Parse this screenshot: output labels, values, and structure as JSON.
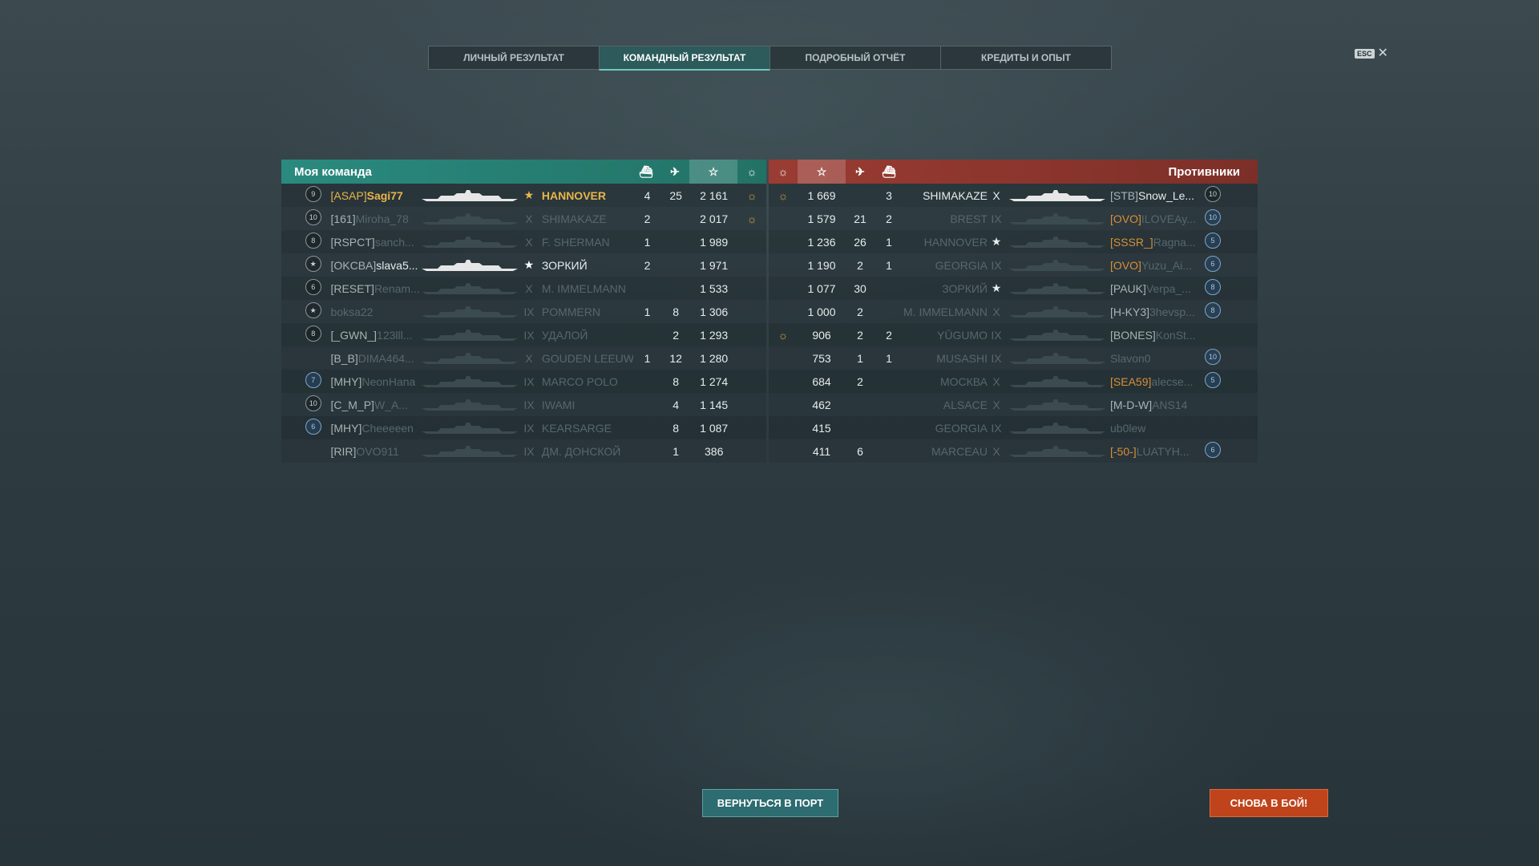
{
  "tabs": [
    {
      "label": "ЛИЧНЫЙ РЕЗУЛЬТАТ"
    },
    {
      "label": "КОМАНДНЫЙ РЕЗУЛЬТАТ"
    },
    {
      "label": "ПОДРОБНЫЙ ОТЧЁТ"
    },
    {
      "label": "КРЕДИТЫ И ОПЫТ"
    }
  ],
  "esc": {
    "key": "ESC",
    "close": "✕"
  },
  "my_team": {
    "title": "Моя команда",
    "rows": [
      {
        "lvl": "9",
        "clan": "[ASAP]",
        "name": "Sagi77",
        "tier": "★",
        "ship": "HANNOVER",
        "kills": "4",
        "planes": "25",
        "xp": "2 161",
        "self": true
      },
      {
        "lvl": "10",
        "clan": "[161]",
        "name": "Miroha_78",
        "tier": "X",
        "ship": "SHIMAKAZE",
        "kills": "2",
        "planes": "",
        "xp": "2 017"
      },
      {
        "lvl": "8",
        "clan": "[RSPCT]",
        "name": "sanch...",
        "tier": "X",
        "ship": "F. SHERMAN",
        "kills": "1",
        "planes": "",
        "xp": "1 989"
      },
      {
        "lvl": "★",
        "clan": "[OKCBA]",
        "name": "slava5...",
        "tier": "★",
        "ship": "ЗОРКИЙ",
        "kills": "2",
        "planes": "",
        "xp": "1 971"
      },
      {
        "lvl": "6",
        "clan": "[RESET]",
        "name": "Renam...",
        "tier": "X",
        "ship": "M. IMMELMANN",
        "kills": "",
        "planes": "",
        "xp": "1 533"
      },
      {
        "lvl": "★",
        "clan": "",
        "name": "boksa22",
        "tier": "IX",
        "ship": "POMMERN",
        "kills": "1",
        "planes": "8",
        "xp": "1 306"
      },
      {
        "lvl": "8",
        "clan": "[_GWN_]",
        "name": "123lll...",
        "tier": "IX",
        "ship": "УДАЛОЙ",
        "kills": "",
        "planes": "2",
        "xp": "1 293"
      },
      {
        "lvl": "",
        "clan": "[B_B]",
        "name": "DIMA464...",
        "tier": "X",
        "ship": "GOUDEN LEEUW",
        "kills": "1",
        "planes": "12",
        "xp": "1 280"
      },
      {
        "lvl": "7",
        "clan": "[MHY]",
        "name": "NeonHana",
        "tier": "IX",
        "ship": "MARCO POLO",
        "kills": "",
        "planes": "8",
        "xp": "1 274"
      },
      {
        "lvl": "10",
        "clan": "[C_M_P]",
        "name": "W_A...",
        "tier": "IX",
        "ship": "IWAMI",
        "kills": "",
        "planes": "4",
        "xp": "1 145"
      },
      {
        "lvl": "6",
        "clan": "[MHY]",
        "name": "Cheeeeen",
        "tier": "IX",
        "ship": "KEARSARGE",
        "kills": "",
        "planes": "8",
        "xp": "1 087"
      },
      {
        "lvl": "",
        "clan": "[RIR]",
        "name": "OVO911",
        "tier": "IX",
        "ship": "ДМ. ДОНСКОЙ",
        "kills": "",
        "planes": "1",
        "xp": "386"
      }
    ]
  },
  "enemies": {
    "title": "Противники",
    "rows": [
      {
        "xp": "1 669",
        "planes": "",
        "kills": "3",
        "ship": "SHIMAKAZE",
        "tier": "X",
        "clan": "[STB]",
        "name": "Snow_Le...",
        "lvl": "10",
        "medal": true
      },
      {
        "xp": "1 579",
        "planes": "21",
        "kills": "2",
        "ship": "BREST",
        "tier": "IX",
        "clan": "[OVO]",
        "name": "ILOVEAy...",
        "lvl": "10"
      },
      {
        "xp": "1 236",
        "planes": "26",
        "kills": "1",
        "ship": "HANNOVER",
        "tier": "★",
        "clan": "[SSSR_]",
        "name": "Ragna...",
        "lvl": "5"
      },
      {
        "xp": "1 190",
        "planes": "2",
        "kills": "1",
        "ship": "GEORGIA",
        "tier": "IX",
        "clan": "[OVO]",
        "name": "Yuzu_Ai...",
        "lvl": "6"
      },
      {
        "xp": "1 077",
        "planes": "30",
        "kills": "",
        "ship": "ЗОРКИЙ",
        "tier": "★",
        "clan": "[PAUK]",
        "name": "Verpa_...",
        "lvl": "8"
      },
      {
        "xp": "1 000",
        "planes": "2",
        "kills": "",
        "ship": "M. IMMELMANN",
        "tier": "X",
        "clan": "[H-KY3]",
        "name": "3hevsp...",
        "lvl": "8"
      },
      {
        "xp": "906",
        "planes": "2",
        "kills": "2",
        "ship": "YŪGUMO",
        "tier": "IX",
        "clan": "[BONES]",
        "name": "KonSt...",
        "lvl": "",
        "medal": true
      },
      {
        "xp": "753",
        "planes": "1",
        "kills": "1",
        "ship": "MUSASHI",
        "tier": "IX",
        "clan": "",
        "name": "Slavon0",
        "lvl": "10"
      },
      {
        "xp": "684",
        "planes": "2",
        "kills": "",
        "ship": "МОСКВА",
        "tier": "X",
        "clan": "[SEA59]",
        "name": "alecse...",
        "lvl": "5"
      },
      {
        "xp": "462",
        "planes": "",
        "kills": "",
        "ship": "ALSACE",
        "tier": "X",
        "clan": "[M-D-W]",
        "name": "ANS14",
        "lvl": ""
      },
      {
        "xp": "415",
        "planes": "",
        "kills": "",
        "ship": "GEORGIA",
        "tier": "IX",
        "clan": "",
        "name": "ub0lew",
        "lvl": ""
      },
      {
        "xp": "411",
        "planes": "6",
        "kills": "",
        "ship": "MARCEAU",
        "tier": "X",
        "clan": "[-50-]",
        "name": "LUATYH...",
        "lvl": "6"
      }
    ]
  },
  "buttons": {
    "port": "ВЕРНУТЬСЯ В ПОРТ",
    "battle": "СНОВА В БОЙ!"
  },
  "colors": {
    "my_team": "#2a8a7f",
    "enemy": "#9a3c33",
    "battle_button": "#c0441b",
    "port_button": "#2d6c70"
  }
}
